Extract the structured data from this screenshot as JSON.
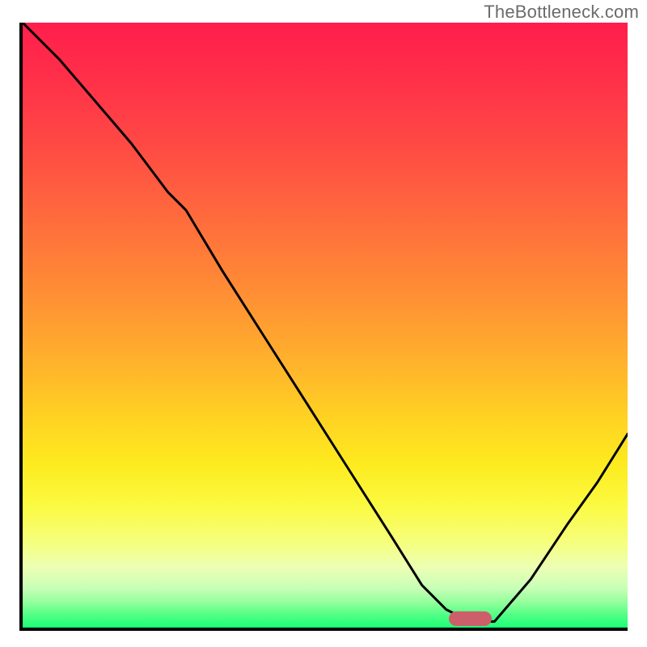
{
  "watermark": "TheBottleneck.com",
  "colors": {
    "axis": "#000000",
    "curve": "#000000",
    "marker": "#cd5f6b",
    "gradient_top": "#ff1e4c",
    "gradient_bottom": "#1bff77",
    "watermark_text": "#6b6b6b"
  },
  "chart_data": {
    "type": "line",
    "title": "",
    "xlabel": "",
    "ylabel": "",
    "xlim": [
      0,
      100
    ],
    "ylim": [
      0,
      100
    ],
    "grid": false,
    "series": [
      {
        "name": "bottleneck_curve",
        "x": [
          0,
          6,
          12,
          18,
          24,
          27,
          33,
          40,
          47,
          54,
          61,
          66,
          70,
          74,
          78,
          84,
          90,
          95,
          100
        ],
        "y": [
          100,
          94,
          87,
          80,
          72,
          69,
          59,
          48,
          37,
          26,
          15,
          7,
          3,
          1,
          1,
          8,
          17,
          24,
          32
        ]
      }
    ],
    "annotations": [
      {
        "name": "optimal_marker",
        "shape": "pill",
        "x_center": 74,
        "y_center": 1.5,
        "width_pct": 7,
        "color": "#cd5f6b"
      }
    ],
    "background_gradient_stops": [
      {
        "pos": 0.0,
        "color": "#ff1e4c"
      },
      {
        "pos": 0.2,
        "color": "#ff4944"
      },
      {
        "pos": 0.44,
        "color": "#ff8c35"
      },
      {
        "pos": 0.65,
        "color": "#ffd123"
      },
      {
        "pos": 0.8,
        "color": "#fbfa42"
      },
      {
        "pos": 0.9,
        "color": "#edffb4"
      },
      {
        "pos": 0.96,
        "color": "#8eff9a"
      },
      {
        "pos": 1.0,
        "color": "#1bff77"
      }
    ]
  }
}
